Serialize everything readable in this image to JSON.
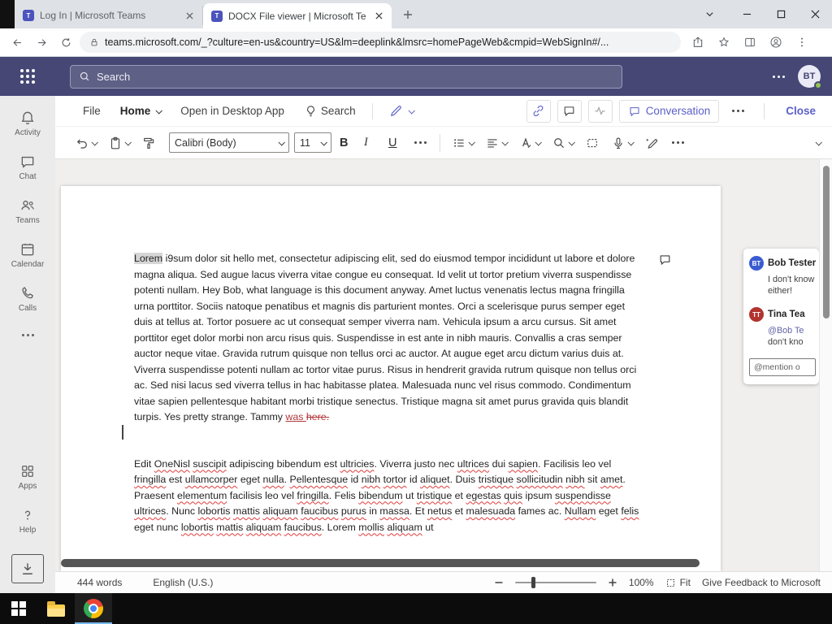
{
  "browser": {
    "tab1": {
      "title": "Log In | Microsoft Teams",
      "favicon": "T"
    },
    "tab2": {
      "title": "DOCX File viewer | Microsoft Tea",
      "favicon": "T"
    },
    "url": "teams.microsoft.com/_?culture=en-us&country=US&lm=deeplink&lmsrc=homePageWeb&cmpid=WebSignIn#/..."
  },
  "teams_header": {
    "search_placeholder": "Search",
    "avatar_initials": "BT"
  },
  "rail": {
    "items": [
      {
        "label": "Activity"
      },
      {
        "label": "Chat"
      },
      {
        "label": "Teams"
      },
      {
        "label": "Calendar"
      },
      {
        "label": "Calls"
      },
      {
        "label": ""
      },
      {
        "label": "Apps"
      },
      {
        "label": "Help"
      }
    ]
  },
  "toolbar": {
    "file": "File",
    "home": "Home",
    "open_desktop": "Open in Desktop App",
    "search": "Search",
    "conversation": "Conversation",
    "close": "Close"
  },
  "format_toolbar": {
    "font_name": "Calibri (Body)",
    "font_size": "11",
    "bold": "B",
    "italic": "I",
    "underline": "U"
  },
  "document": {
    "paragraph1": [
      {
        "text": "Lorem",
        "style": "cursor"
      },
      {
        "text": " i9sum dolor sit hello met, consectetur adipiscing elit, sed do eiusmod tempor incididunt ut labore et dolore magna aliqua. Sed augue lacus viverra vitae congue eu consequat. Id velit ut tortor pretium viverra suspendisse potenti nullam.  Hey Bob, what language is this document anyway.  Amet luctus venenatis lectus magna fringilla urna porttitor. Sociis natoque penatibus et magnis dis parturient montes. Orci a scelerisque purus semper eget duis at tellus at. Tortor posuere ac ut consequat semper viverra nam. Vehicula ipsum a arcu cursus. Sit amet porttitor eget dolor morbi non arcu risus quis. Suspendisse in est ante in nibh mauris. Convallis a cras semper auctor neque vitae. Gravida rutrum quisque non tellus orci ac auctor. At augue eget arcu dictum varius duis at. Viverra suspendisse potenti nullam ac tortor vitae purus. Risus in hendrerit gravida rutrum quisque non tellus orci ac. Sed nisi lacus sed viverra tellus in hac habitasse platea. Malesuada nunc vel risus commodo. Condimentum vitae sapien pellentesque habitant morbi tristique senectus. Tristique magna sit amet purus gravida quis blandit turpis.  Yes pretty strange. Tammy ",
        "style": "normal"
      },
      {
        "text": "was ",
        "style": "ins"
      },
      {
        "text": "here.",
        "style": "del"
      }
    ],
    "paragraph2": [
      {
        "text": "Edit ",
        "style": "normal"
      },
      {
        "text": "OneNisl",
        "style": "miss"
      },
      {
        "text": " ",
        "style": "normal"
      },
      {
        "text": "suscipit",
        "style": "miss"
      },
      {
        "text": " adipiscing bibendum est ",
        "style": "normal"
      },
      {
        "text": "ultricies",
        "style": "miss"
      },
      {
        "text": ". Viverra justo nec ",
        "style": "normal"
      },
      {
        "text": "ultrices",
        "style": "miss"
      },
      {
        "text": " dui ",
        "style": "normal"
      },
      {
        "text": "sapien",
        "style": "miss"
      },
      {
        "text": ". Facilisis leo vel ",
        "style": "normal"
      },
      {
        "text": "fringilla",
        "style": "miss"
      },
      {
        "text": " est ",
        "style": "normal"
      },
      {
        "text": "ullamcorper",
        "style": "miss"
      },
      {
        "text": " eget ",
        "style": "normal"
      },
      {
        "text": "nulla",
        "style": "miss"
      },
      {
        "text": ". ",
        "style": "normal"
      },
      {
        "text": "Pellentesque",
        "style": "miss"
      },
      {
        "text": " id ",
        "style": "normal"
      },
      {
        "text": "nibh",
        "style": "miss"
      },
      {
        "text": " ",
        "style": "normal"
      },
      {
        "text": "tortor",
        "style": "miss"
      },
      {
        "text": " id ",
        "style": "normal"
      },
      {
        "text": "aliquet",
        "style": "miss"
      },
      {
        "text": ". Duis ",
        "style": "normal"
      },
      {
        "text": "tristique",
        "style": "miss"
      },
      {
        "text": " ",
        "style": "normal"
      },
      {
        "text": "sollicitudin",
        "style": "miss"
      },
      {
        "text": " ",
        "style": "normal"
      },
      {
        "text": "nibh",
        "style": "miss"
      },
      {
        "text": " sit ",
        "style": "normal"
      },
      {
        "text": "amet",
        "style": "miss"
      },
      {
        "text": ". Praesent ",
        "style": "normal"
      },
      {
        "text": "elementum",
        "style": "miss"
      },
      {
        "text": " facilisis leo vel ",
        "style": "normal"
      },
      {
        "text": "fringilla",
        "style": "miss"
      },
      {
        "text": ". Felis ",
        "style": "normal"
      },
      {
        "text": "bibendum",
        "style": "miss"
      },
      {
        "text": " ut ",
        "style": "normal"
      },
      {
        "text": "tristique",
        "style": "miss"
      },
      {
        "text": " et ",
        "style": "normal"
      },
      {
        "text": "egestas",
        "style": "miss"
      },
      {
        "text": " ",
        "style": "normal"
      },
      {
        "text": "quis",
        "style": "miss"
      },
      {
        "text": " ipsum ",
        "style": "normal"
      },
      {
        "text": "suspendisse",
        "style": "miss"
      },
      {
        "text": " ",
        "style": "normal"
      },
      {
        "text": "ultrices",
        "style": "miss"
      },
      {
        "text": ". Nunc ",
        "style": "normal"
      },
      {
        "text": "lobortis",
        "style": "miss"
      },
      {
        "text": " ",
        "style": "normal"
      },
      {
        "text": "mattis",
        "style": "miss"
      },
      {
        "text": " ",
        "style": "normal"
      },
      {
        "text": "aliquam",
        "style": "miss"
      },
      {
        "text": " ",
        "style": "normal"
      },
      {
        "text": "faucibus",
        "style": "miss"
      },
      {
        "text": " ",
        "style": "normal"
      },
      {
        "text": "purus",
        "style": "miss"
      },
      {
        "text": " in ",
        "style": "normal"
      },
      {
        "text": "massa",
        "style": "miss"
      },
      {
        "text": ". Et ",
        "style": "normal"
      },
      {
        "text": "netus",
        "style": "miss"
      },
      {
        "text": " et ",
        "style": "normal"
      },
      {
        "text": "malesuada",
        "style": "miss"
      },
      {
        "text": " fames ac. ",
        "style": "normal"
      },
      {
        "text": "Nullam",
        "style": "miss"
      },
      {
        "text": " eget ",
        "style": "normal"
      },
      {
        "text": "felis",
        "style": "miss"
      },
      {
        "text": " eget nunc ",
        "style": "normal"
      },
      {
        "text": "lobortis",
        "style": "miss"
      },
      {
        "text": " ",
        "style": "normal"
      },
      {
        "text": "mattis",
        "style": "miss"
      },
      {
        "text": " ",
        "style": "normal"
      },
      {
        "text": "aliquam",
        "style": "miss"
      },
      {
        "text": " ",
        "style": "normal"
      },
      {
        "text": "faucibus",
        "style": "miss"
      },
      {
        "text": ". Lorem ",
        "style": "normal"
      },
      {
        "text": "mollis",
        "style": "miss"
      },
      {
        "text": " ",
        "style": "normal"
      },
      {
        "text": "aliquam",
        "style": "miss"
      },
      {
        "text": " ut",
        "style": "normal"
      }
    ]
  },
  "comments": {
    "comment1": {
      "initials": "BT",
      "name": "Bob Tester",
      "text": "I don't know either!"
    },
    "comment2": {
      "initials": "TT",
      "name": "Tina Tea",
      "mention": "@Bob Te",
      "text": "don't kno"
    },
    "reply_placeholder": "@mention o"
  },
  "status_bar": {
    "words": "444 words",
    "language": "English (U.S.)",
    "zoom": "100%",
    "fit": "Fit",
    "feedback": "Give Feedback to Microsoft"
  }
}
